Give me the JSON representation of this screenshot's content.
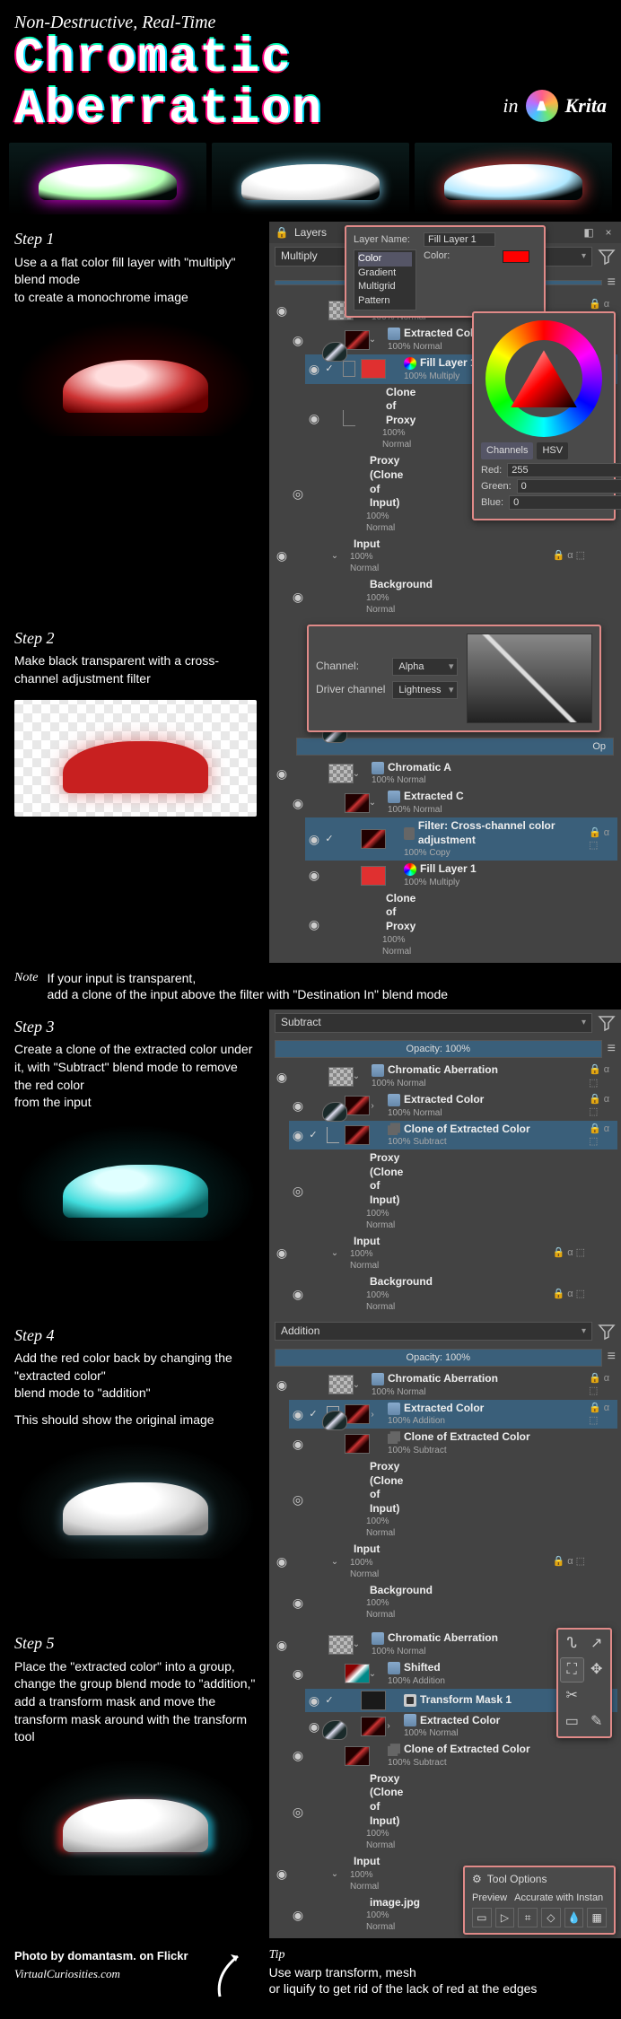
{
  "header": {
    "subtitle": "Non-Destructive, Real-Time",
    "title1": "Chromatic",
    "title2": "Aberration",
    "in": "in",
    "app": "Krita"
  },
  "panel": {
    "layers_title": "Layers",
    "close": "×",
    "layerprops": {
      "name_label": "Layer Name:",
      "name_value": "Fill Layer 1",
      "opt_color": "Color",
      "opt_gradient": "Gradient",
      "opt_multigrid": "Multigrid",
      "opt_pattern": "Pattern",
      "color_label": "Color:"
    },
    "color": {
      "channels_tab": "Channels",
      "hsv_tab": "HSV",
      "red_label": "Red:",
      "red_val": "255",
      "green_label": "Green:",
      "green_val": "0",
      "blue_label": "Blue:",
      "blue_val": "0"
    },
    "xchannel": {
      "channel_label": "Channel:",
      "channel_val": "Alpha",
      "driver_label": "Driver channel",
      "driver_val": "Lightness"
    },
    "tooloptions": {
      "title": "Tool Options",
      "preview": "Preview",
      "accurate": "Accurate with Instan"
    },
    "opacity": "Opacity:  100%"
  },
  "blend": {
    "multiply": "Multiply",
    "subtract": "Subtract",
    "addition": "Addition"
  },
  "layers": {
    "ca": "Chromatic Aberration",
    "ca_short": "Chromatic A",
    "normal100": "100% Normal",
    "extracted": "Extracted Color",
    "extracted_short": "Extracted C",
    "multiply100": "100% Multiply",
    "fill1": "Fill Layer 1",
    "clone_proxy": "Clone of Proxy",
    "proxy": "Proxy (Clone of Input)",
    "input": "Input",
    "background": "Background",
    "filter_xch": "Filter: Cross-channel color adjustment",
    "copy100": "100% Copy",
    "clone_extracted": "Clone of Extracted Color",
    "subtract100": "100% Subtract",
    "addition100": "100% Addition",
    "shifted": "Shifted",
    "tmask": "Transform Mask 1",
    "image": "image.jpg",
    "op_partial": "Op"
  },
  "steps": {
    "s1h": "Step 1",
    "s1": "Use a a flat color fill layer with \"multiply\" blend mode\nto create a monochrome image",
    "s2h": "Step 2",
    "s2": "Make black transparent with a cross-channel adjustment filter",
    "noteh": "Note",
    "note": "If your input is transparent,\nadd a clone of the input above the filter with \"Destination In\" blend mode",
    "s3h": "Step 3",
    "s3": "Create a clone of the extracted color under it, with \"Subtract\" blend mode to remove the red color\nfrom the input",
    "s4h": "Step 4",
    "s4a": "Add the red color back by changing the \"extracted color\"\nblend mode to \"addition\"",
    "s4b": "This should show the original image",
    "s5h": "Step 5",
    "s5": "Place the \"extracted color\" into a group, change the group blend mode to \"addition,\" add a transform mask and move the transform mask around with the transform tool"
  },
  "footer": {
    "credit1": "Photo by domantasm. on Flickr",
    "credit2": "VirtualCuriosities.com",
    "tiph": "Tip",
    "tip": "Use warp transform, mesh\nor liquify to get rid of the lack of red at the edges"
  }
}
